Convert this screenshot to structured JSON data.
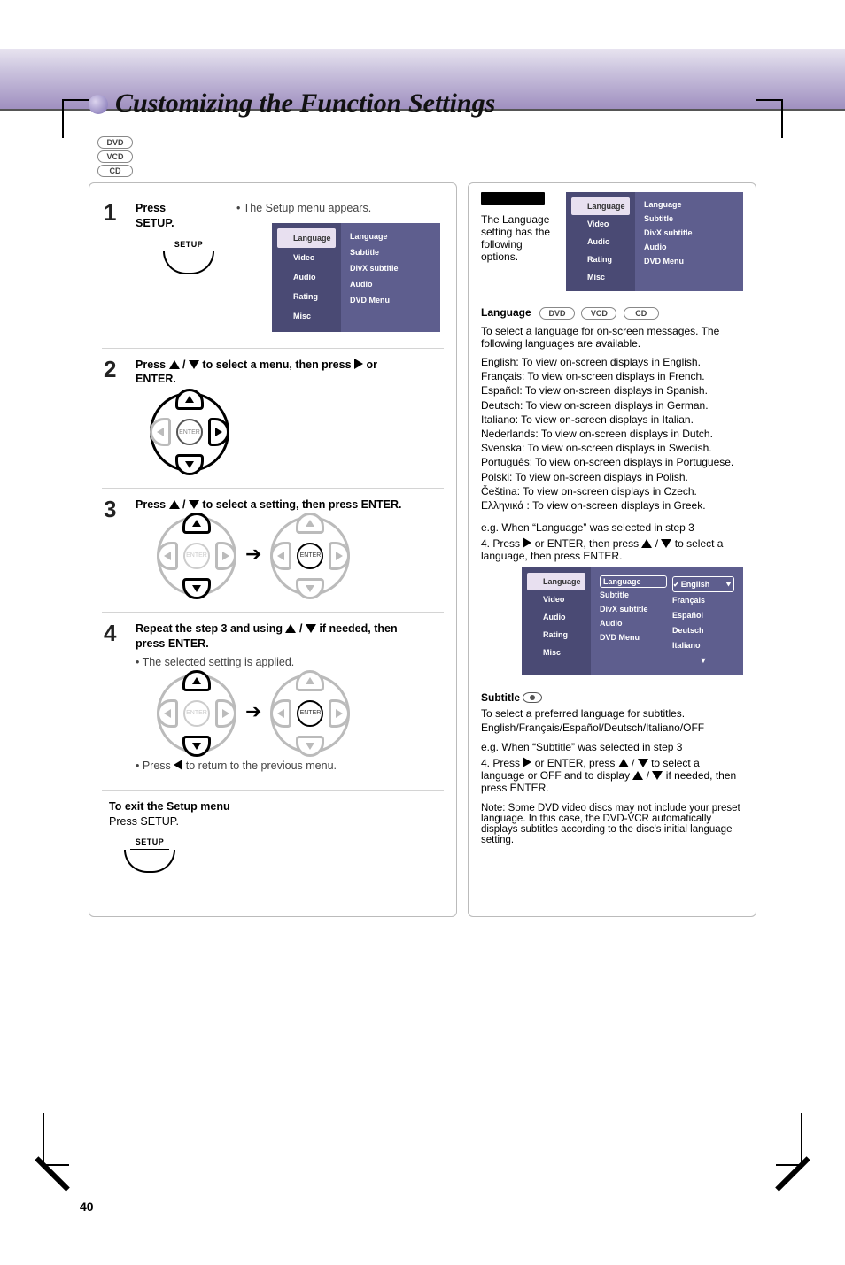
{
  "header_band": true,
  "section_title": "Customizing the Function Settings",
  "top_badges": [
    "DVD",
    "VCD",
    "CD"
  ],
  "menu": {
    "tabs": [
      "Language",
      "Video",
      "Audio",
      "Rating",
      "Misc"
    ],
    "items": [
      "Language",
      "Subtitle",
      "DivX subtitle",
      "Audio",
      "DVD Menu"
    ],
    "lang_options": [
      "English",
      "Français",
      "Español",
      "Deutsch",
      "Italiano"
    ]
  },
  "left_steps": {
    "s1": {
      "line1": "Press",
      "line2": "SETUP.",
      "after": "• The Setup menu appears."
    },
    "s2": {
      "line1": "Press       /       to select a menu, then press         or",
      "line2": "ENTER."
    },
    "s3": {
      "line1": "Press       /       to select a setting, then press ENTER.",
      "line2": ""
    },
    "s4": {
      "line1": "Repeat the step 3 and using       /       if needed, then",
      "line2": "press ENTER."
    },
    "note4": {
      "a": "• The selected setting is applied.",
      "b": "• Press         to return to the previous menu."
    },
    "exit": {
      "title": "To exit the Setup menu",
      "body": "Press SETUP."
    }
  },
  "right": {
    "block_top": {
      "heading": "Language",
      "intro": "The Language setting has the following options.",
      "titles": {
        "language": "Language",
        "subtitle": "Subtitle",
        "divx": "DivX subtitle",
        "audio": "Audio",
        "dvdmenu": "DVD Menu"
      },
      "lang_desc": "To select a language for on-screen messages. The following languages are available.",
      "lang_list": [
        "English: To view on-screen displays in English.",
        "Français: To view on-screen displays in French.",
        "Español: To view on-screen displays in Spanish.",
        "Deutsch: To view on-screen displays in German.",
        "Italiano: To view on-screen displays in Italian.",
        "Nederlands: To view on-screen displays in Dutch.",
        "Svenska: To view on-screen displays in Swedish.",
        "Português: To view on-screen displays in Portuguese.",
        "Polski: To view on-screen displays in Polish.",
        "Čeština: To view on-screen displays in Czech.",
        "Ελληνικά : To view on-screen displays in Greek."
      ],
      "eg": "e.g. When “Language” was selected in step 3",
      "s4line": "4. Press         or ENTER, then press       /       to select a language, then press ENTER."
    },
    "subtitle_blk": {
      "heading": "Subtitle",
      "body1": "To select a preferred language for subtitles.",
      "options": "English/Français/Español/Deutsch/Italiano/OFF",
      "body2": "e.g. When “Subtitle” was selected in step 3",
      "s4line": "4. Press         or ENTER, press       /       to select a language or OFF and to display       /       if needed, then press ENTER.",
      "note": "Note: Some DVD video discs may not include your preset language. In this case, the DVD-VCR automatically displays subtitles according to the disc's initial language setting."
    }
  },
  "page_number": "40"
}
